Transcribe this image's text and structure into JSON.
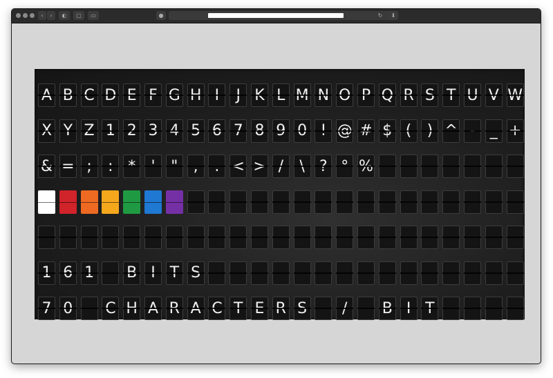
{
  "browser": {
    "toolbar_icons": [
      "back-chevron-icon",
      "forward-chevron-icon",
      "privacy-icon",
      "tabs-icon",
      "sidebar-icon",
      "extension-icon",
      "reload-icon",
      "download-icon"
    ]
  },
  "board": {
    "columns": 23,
    "rows": [
      [
        "A",
        "B",
        "C",
        "D",
        "E",
        "F",
        "G",
        "H",
        "I",
        "J",
        "K",
        "L",
        "M",
        "N",
        "O",
        "P",
        "Q",
        "R",
        "S",
        "T",
        "U",
        "V",
        "W"
      ],
      [
        "X",
        "Y",
        "Z",
        "1",
        "2",
        "3",
        "4",
        "5",
        "6",
        "7",
        "8",
        "9",
        "0",
        "!",
        "@",
        "#",
        "$",
        "(",
        ")",
        "^",
        "-",
        "_",
        "+"
      ],
      [
        "&",
        "=",
        ";",
        ":",
        "*",
        "'",
        "\"",
        ",",
        ".",
        "<",
        ">",
        "/",
        "\\",
        "?",
        "°",
        "%",
        "",
        "",
        "",
        "",
        "",
        "",
        ""
      ],
      [
        "",
        "",
        "",
        "",
        "",
        "",
        "",
        "",
        "",
        "",
        "",
        "",
        "",
        "",
        "",
        "",
        "",
        "",
        "",
        "",
        "",
        "",
        ""
      ],
      [
        "",
        "",
        "",
        "",
        "",
        "",
        "",
        "",
        "",
        "",
        "",
        "",
        "",
        "",
        "",
        "",
        "",
        "",
        "",
        "",
        "",
        "",
        ""
      ],
      [
        "1",
        "6",
        "1",
        "",
        "B",
        "I",
        "T",
        "S",
        "",
        "",
        "",
        "",
        "",
        "",
        "",
        "",
        "",
        "",
        "",
        "",
        "",
        "",
        ""
      ],
      [
        "7",
        "0",
        "",
        "C",
        "H",
        "A",
        "R",
        "A",
        "C",
        "T",
        "E",
        "R",
        "S",
        "",
        "/",
        "",
        "B",
        "I",
        "T",
        "",
        "",
        "",
        ""
      ]
    ],
    "color_row": 3,
    "colors": [
      "#ffffff",
      "#d0232a",
      "#ee6a23",
      "#f6a81d",
      "#1f9a42",
      "#1f78d1",
      "#7630a6"
    ],
    "status": {
      "count": "161",
      "count_unit": "BITS",
      "ratio": "70",
      "ratio_text": "CHARACTERS / BIT"
    }
  }
}
